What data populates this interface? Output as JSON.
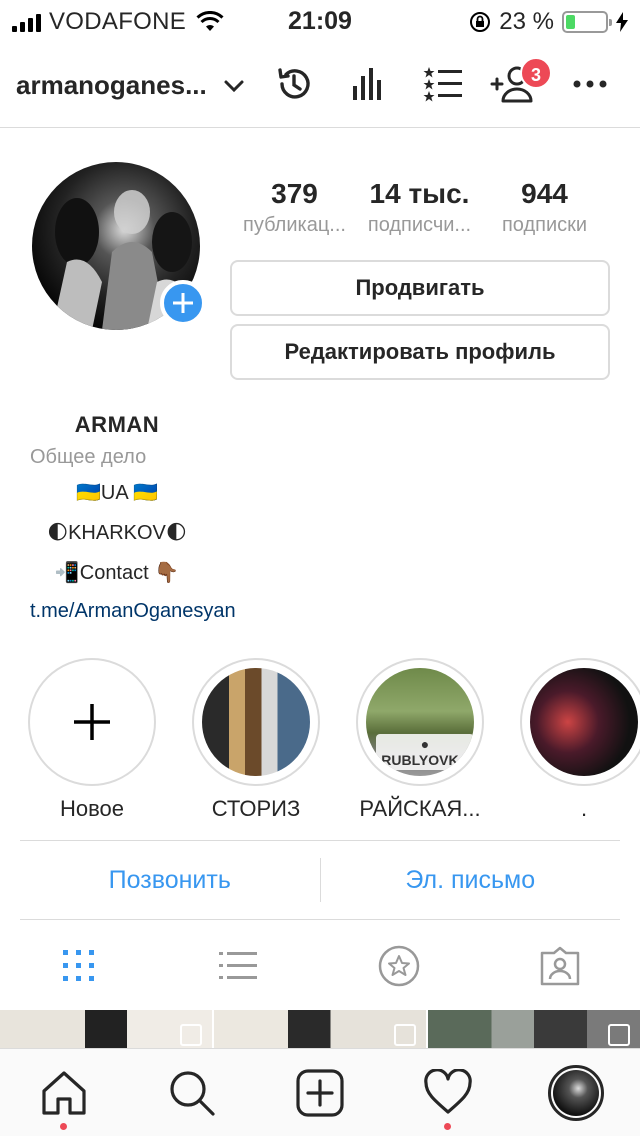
{
  "status_bar": {
    "carrier": "VODAFONE",
    "time": "21:09",
    "battery_percent": "23 %",
    "battery_level": 0.23
  },
  "header": {
    "username": "armanoganes...",
    "notification_count": "3",
    "icons": [
      "chevron-down-icon",
      "history-icon",
      "insights-icon",
      "close-friends-list-icon",
      "add-user-icon",
      "more-icon"
    ]
  },
  "profile": {
    "stats": [
      {
        "value": "379",
        "label": "публикац..."
      },
      {
        "value": "14 тыс.",
        "label": "подписчи..."
      },
      {
        "value": "944",
        "label": "подписки"
      }
    ],
    "promote_label": "Продвигать",
    "edit_profile_label": "Редактировать профиль"
  },
  "bio": {
    "name": "ARMAN",
    "category": "Общее дело",
    "lines": [
      "🇺🇦UA 🇺🇦",
      "🌓KHARKOV🌓",
      "📲Contact 👇🏾"
    ],
    "link": "t.me/ArmanOganesyan"
  },
  "highlights": [
    {
      "label": "Новое"
    },
    {
      "label": "СТОРИЗ"
    },
    {
      "label": "РАЙСКАЯ..."
    },
    {
      "label": "."
    }
  ],
  "highlight_overlay_texts": [
    "RUBLYOVKA"
  ],
  "contact": {
    "call_label": "Позвонить",
    "email_label": "Эл. письмо"
  },
  "tabs": [
    "grid-icon",
    "list-icon",
    "star-icon",
    "tagged-icon"
  ],
  "bottom_nav": [
    "home-icon",
    "search-icon",
    "new-post-icon",
    "heart-icon",
    "profile-avatar"
  ],
  "colors": {
    "accent": "#3897f0",
    "badge": "#ed4956",
    "muted": "#999999",
    "link": "#003569",
    "battery": "#4cd964"
  }
}
